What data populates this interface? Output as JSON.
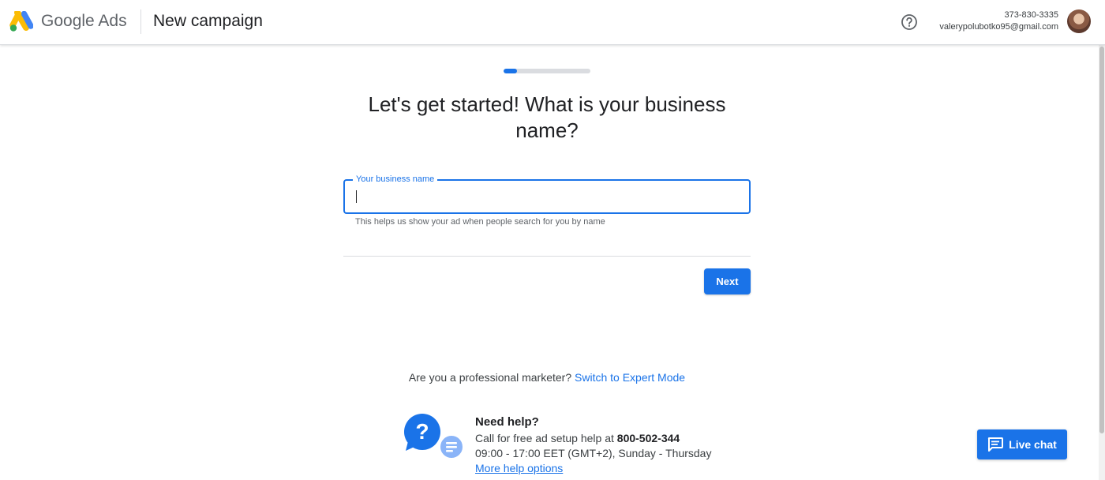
{
  "header": {
    "brand_google": "Google",
    "brand_ads": "Ads",
    "title": "New campaign",
    "account_phone": "373-830-3335",
    "account_email": "valerypolubotko95@gmail.com",
    "icons": {
      "logo": "google-ads-logo",
      "help": "help-circle-icon",
      "avatar": "user-avatar"
    }
  },
  "progress": {
    "value": 0.15,
    "color": "#1a73e8"
  },
  "form": {
    "question": "Let's get started! What is your business name?",
    "field_label": "Your business name",
    "field_value": "",
    "hint": "This helps us show your ad when people search for you by name",
    "next_label": "Next"
  },
  "expert": {
    "prompt": "Are you a professional marketer?",
    "link": "Switch to Expert Mode"
  },
  "help": {
    "title": "Need help?",
    "call_text": "Call for free ad setup help at ",
    "phone": "800-502-344",
    "hours": "09:00 - 17:00 EET (GMT+2), Sunday - Thursday",
    "more_link": "More help options",
    "icon": "help-chat-illustration"
  },
  "live_chat": {
    "label": "Live chat",
    "icon": "chat-icon"
  },
  "colors": {
    "accent": "#1a73e8",
    "text": "#202124",
    "muted": "#5f6368"
  }
}
